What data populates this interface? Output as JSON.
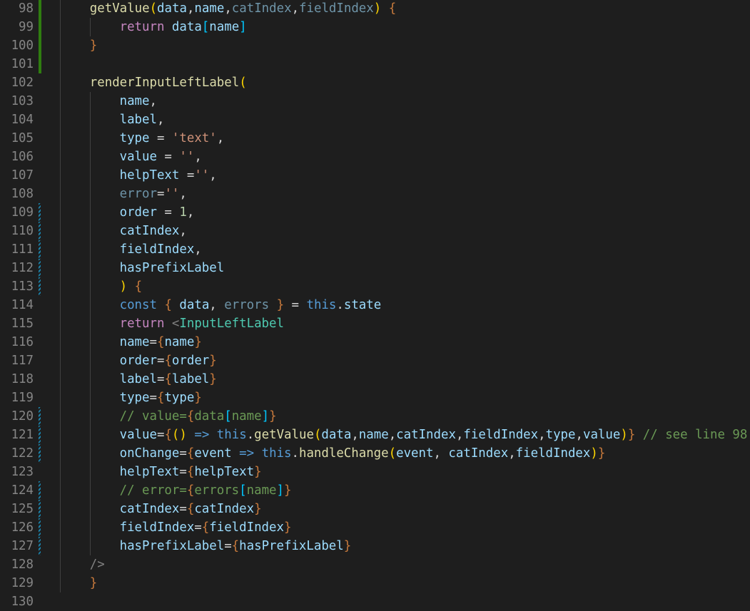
{
  "editor": {
    "language": "javascript-react",
    "theme_colors": {
      "background": "#1e1e1e",
      "line_number": "#858585",
      "added_marker": "#2f7d10",
      "modified_marker": "#1b81a8"
    },
    "lines": [
      {
        "number": "98",
        "indent": 1,
        "marker": "added",
        "tokens": [
          [
            "t-fn",
            "getValue"
          ],
          [
            "t-br1",
            "("
          ],
          [
            "t-var",
            "data"
          ],
          [
            "t-punc",
            ","
          ],
          [
            "t-var",
            "name"
          ],
          [
            "t-punc",
            ","
          ],
          [
            "t-dim",
            "catIndex"
          ],
          [
            "t-punc",
            ","
          ],
          [
            "t-dim",
            "fieldIndex"
          ],
          [
            "t-br1",
            ")"
          ],
          [
            "t-punc",
            " "
          ],
          [
            "t-ob",
            "{"
          ]
        ]
      },
      {
        "number": "99",
        "indent": 2,
        "marker": "added",
        "tokens": [
          [
            "t-kw",
            "return"
          ],
          [
            "t-punc",
            " "
          ],
          [
            "t-var",
            "data"
          ],
          [
            "t-bracket",
            "["
          ],
          [
            "t-var",
            "name"
          ],
          [
            "t-bracket",
            "]"
          ]
        ]
      },
      {
        "number": "100",
        "indent": 1,
        "marker": "added",
        "tokens": [
          [
            "t-ob",
            "}"
          ]
        ]
      },
      {
        "number": "101",
        "indent": 0,
        "marker": "added",
        "tokens": []
      },
      {
        "number": "102",
        "indent": 1,
        "marker": "",
        "tokens": [
          [
            "t-fn",
            "renderInputLeftLabel"
          ],
          [
            "t-br1",
            "("
          ]
        ]
      },
      {
        "number": "103",
        "indent": 2,
        "marker": "",
        "tokens": [
          [
            "t-var",
            "name"
          ],
          [
            "t-punc",
            ","
          ]
        ]
      },
      {
        "number": "104",
        "indent": 2,
        "marker": "",
        "tokens": [
          [
            "t-var",
            "label"
          ],
          [
            "t-punc",
            ","
          ]
        ]
      },
      {
        "number": "105",
        "indent": 2,
        "marker": "",
        "tokens": [
          [
            "t-var",
            "type"
          ],
          [
            "t-punc",
            " = "
          ],
          [
            "t-str",
            "'text'"
          ],
          [
            "t-punc",
            ","
          ]
        ]
      },
      {
        "number": "106",
        "indent": 2,
        "marker": "",
        "tokens": [
          [
            "t-var",
            "value"
          ],
          [
            "t-punc",
            " = "
          ],
          [
            "t-str",
            "''"
          ],
          [
            "t-punc",
            ","
          ]
        ]
      },
      {
        "number": "107",
        "indent": 2,
        "marker": "",
        "tokens": [
          [
            "t-var",
            "helpText"
          ],
          [
            "t-punc",
            " ="
          ],
          [
            "t-str",
            "''"
          ],
          [
            "t-punc",
            ","
          ]
        ]
      },
      {
        "number": "108",
        "indent": 2,
        "marker": "",
        "tokens": [
          [
            "t-dim",
            "error"
          ],
          [
            "t-punc",
            "="
          ],
          [
            "t-str",
            "''"
          ],
          [
            "t-punc",
            ","
          ]
        ]
      },
      {
        "number": "109",
        "indent": 2,
        "marker": "modified",
        "tokens": [
          [
            "t-var",
            "order"
          ],
          [
            "t-punc",
            " = "
          ],
          [
            "t-num",
            "1"
          ],
          [
            "t-punc",
            ","
          ]
        ]
      },
      {
        "number": "110",
        "indent": 2,
        "marker": "modified",
        "tokens": [
          [
            "t-var",
            "catIndex"
          ],
          [
            "t-punc",
            ","
          ]
        ]
      },
      {
        "number": "111",
        "indent": 2,
        "marker": "modified",
        "tokens": [
          [
            "t-var",
            "fieldIndex"
          ],
          [
            "t-punc",
            ","
          ]
        ]
      },
      {
        "number": "112",
        "indent": 2,
        "marker": "modified",
        "tokens": [
          [
            "t-var",
            "hasPrefixLabel"
          ]
        ]
      },
      {
        "number": "113",
        "indent": 2,
        "marker": "modified",
        "tokens": [
          [
            "t-br1",
            ")"
          ],
          [
            "t-punc",
            " "
          ],
          [
            "t-ob",
            "{"
          ]
        ]
      },
      {
        "number": "114",
        "indent": 2,
        "marker": "",
        "tokens": [
          [
            "t-kw2",
            "const"
          ],
          [
            "t-punc",
            " "
          ],
          [
            "t-ob",
            "{"
          ],
          [
            "t-punc",
            " "
          ],
          [
            "t-var",
            "data"
          ],
          [
            "t-punc",
            ", "
          ],
          [
            "t-dim",
            "errors"
          ],
          [
            "t-punc",
            " "
          ],
          [
            "t-ob",
            "}"
          ],
          [
            "t-punc",
            " = "
          ],
          [
            "t-kw2",
            "this"
          ],
          [
            "t-punc",
            "."
          ],
          [
            "t-var",
            "state"
          ]
        ]
      },
      {
        "number": "115",
        "indent": 2,
        "marker": "",
        "tokens": [
          [
            "t-kw",
            "return"
          ],
          [
            "t-punc",
            " "
          ],
          [
            "t-tag",
            "<"
          ],
          [
            "t-comp",
            "InputLeftLabel"
          ]
        ]
      },
      {
        "number": "116",
        "indent": 2,
        "marker": "",
        "tokens": [
          [
            "t-var",
            "name"
          ],
          [
            "t-punc",
            "="
          ],
          [
            "t-ob",
            "{"
          ],
          [
            "t-var",
            "name"
          ],
          [
            "t-ob",
            "}"
          ]
        ]
      },
      {
        "number": "117",
        "indent": 2,
        "marker": "",
        "tokens": [
          [
            "t-var",
            "order"
          ],
          [
            "t-punc",
            "="
          ],
          [
            "t-ob",
            "{"
          ],
          [
            "t-var",
            "order"
          ],
          [
            "t-ob",
            "}"
          ]
        ]
      },
      {
        "number": "118",
        "indent": 2,
        "marker": "",
        "tokens": [
          [
            "t-var",
            "label"
          ],
          [
            "t-punc",
            "="
          ],
          [
            "t-ob",
            "{"
          ],
          [
            "t-var",
            "label"
          ],
          [
            "t-ob",
            "}"
          ]
        ]
      },
      {
        "number": "119",
        "indent": 2,
        "marker": "",
        "tokens": [
          [
            "t-var",
            "type"
          ],
          [
            "t-punc",
            "="
          ],
          [
            "t-ob",
            "{"
          ],
          [
            "t-var",
            "type"
          ],
          [
            "t-ob",
            "}"
          ]
        ]
      },
      {
        "number": "120",
        "indent": 2,
        "marker": "modified",
        "tokens": [
          [
            "t-cmt",
            "// value="
          ],
          [
            "t-ob",
            "{"
          ],
          [
            "t-cmt",
            "data"
          ],
          [
            "t-bracket",
            "["
          ],
          [
            "t-cmt",
            "name"
          ],
          [
            "t-bracket",
            "]"
          ],
          [
            "t-ob",
            "}"
          ]
        ]
      },
      {
        "number": "121",
        "indent": 2,
        "marker": "modified",
        "tokens": [
          [
            "t-var",
            "value"
          ],
          [
            "t-punc",
            "="
          ],
          [
            "t-ob",
            "{"
          ],
          [
            "t-br1",
            "()"
          ],
          [
            "t-punc",
            " "
          ],
          [
            "t-kw2",
            "=>"
          ],
          [
            "t-punc",
            " "
          ],
          [
            "t-kw2",
            "this"
          ],
          [
            "t-punc",
            "."
          ],
          [
            "t-fn",
            "getValue"
          ],
          [
            "t-br1",
            "("
          ],
          [
            "t-var",
            "data"
          ],
          [
            "t-punc",
            ","
          ],
          [
            "t-var",
            "name"
          ],
          [
            "t-punc",
            ","
          ],
          [
            "t-var",
            "catIndex"
          ],
          [
            "t-punc",
            ","
          ],
          [
            "t-var",
            "fieldIndex"
          ],
          [
            "t-punc",
            ","
          ],
          [
            "t-var",
            "type"
          ],
          [
            "t-punc",
            ","
          ],
          [
            "t-var",
            "value"
          ],
          [
            "t-br1",
            ")"
          ],
          [
            "t-ob",
            "}"
          ],
          [
            "t-punc",
            " "
          ],
          [
            "t-cmt",
            "// see line 98"
          ]
        ]
      },
      {
        "number": "122",
        "indent": 2,
        "marker": "modified",
        "tokens": [
          [
            "t-var",
            "onChange"
          ],
          [
            "t-punc",
            "="
          ],
          [
            "t-ob",
            "{"
          ],
          [
            "t-var",
            "event"
          ],
          [
            "t-punc",
            " "
          ],
          [
            "t-kw2",
            "=>"
          ],
          [
            "t-punc",
            " "
          ],
          [
            "t-kw2",
            "this"
          ],
          [
            "t-punc",
            "."
          ],
          [
            "t-fn",
            "handleChange"
          ],
          [
            "t-br1",
            "("
          ],
          [
            "t-var",
            "event"
          ],
          [
            "t-punc",
            ", "
          ],
          [
            "t-var",
            "catIndex"
          ],
          [
            "t-punc",
            ","
          ],
          [
            "t-var",
            "fieldIndex"
          ],
          [
            "t-br1",
            ")"
          ],
          [
            "t-ob",
            "}"
          ]
        ]
      },
      {
        "number": "123",
        "indent": 2,
        "marker": "",
        "tokens": [
          [
            "t-var",
            "helpText"
          ],
          [
            "t-punc",
            "="
          ],
          [
            "t-ob",
            "{"
          ],
          [
            "t-var",
            "helpText"
          ],
          [
            "t-ob",
            "}"
          ]
        ]
      },
      {
        "number": "124",
        "indent": 2,
        "marker": "modified",
        "tokens": [
          [
            "t-cmt",
            "// error="
          ],
          [
            "t-ob",
            "{"
          ],
          [
            "t-cmt",
            "errors"
          ],
          [
            "t-bracket",
            "["
          ],
          [
            "t-cmt",
            "name"
          ],
          [
            "t-bracket",
            "]"
          ],
          [
            "t-ob",
            "}"
          ]
        ]
      },
      {
        "number": "125",
        "indent": 2,
        "marker": "modified",
        "tokens": [
          [
            "t-var",
            "catIndex"
          ],
          [
            "t-punc",
            "="
          ],
          [
            "t-ob",
            "{"
          ],
          [
            "t-var",
            "catIndex"
          ],
          [
            "t-ob",
            "}"
          ]
        ]
      },
      {
        "number": "126",
        "indent": 2,
        "marker": "modified",
        "tokens": [
          [
            "t-var",
            "fieldIndex"
          ],
          [
            "t-punc",
            "="
          ],
          [
            "t-ob",
            "{"
          ],
          [
            "t-var",
            "fieldIndex"
          ],
          [
            "t-ob",
            "}"
          ]
        ]
      },
      {
        "number": "127",
        "indent": 2,
        "marker": "modified",
        "tokens": [
          [
            "t-var",
            "hasPrefixLabel"
          ],
          [
            "t-punc",
            "="
          ],
          [
            "t-ob",
            "{"
          ],
          [
            "t-var",
            "hasPrefixLabel"
          ],
          [
            "t-ob",
            "}"
          ]
        ]
      },
      {
        "number": "128",
        "indent": 1,
        "marker": "",
        "tokens": [
          [
            "t-tag",
            "/>"
          ]
        ]
      },
      {
        "number": "129",
        "indent": 1,
        "marker": "",
        "tokens": [
          [
            "t-ob",
            "}"
          ]
        ]
      },
      {
        "number": "130",
        "indent": 0,
        "marker": "",
        "tokens": []
      }
    ]
  }
}
